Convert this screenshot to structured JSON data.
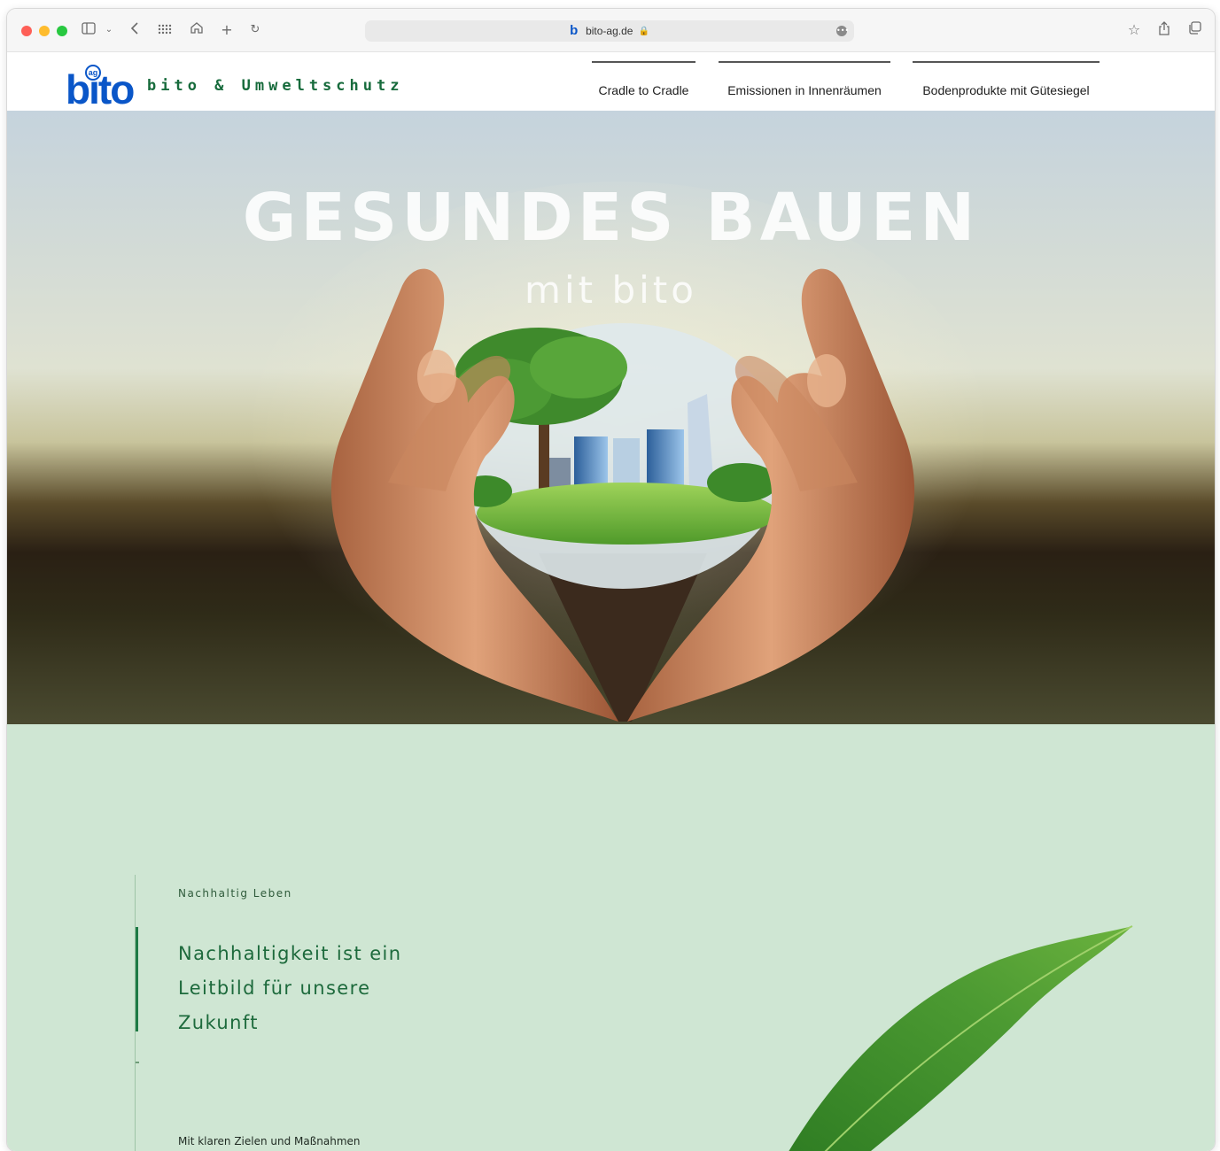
{
  "browser": {
    "url": "bito-ag.de",
    "favicon_letter": "b",
    "lock_glyph": "🔒",
    "icons": [
      "sidebar-icon",
      "chevron-down-icon",
      "back-icon",
      "grid-icon",
      "home-icon",
      "plus-icon",
      "reload-icon",
      "star-icon",
      "share-icon",
      "tabs-icon"
    ]
  },
  "site": {
    "logo_text": "bito",
    "logo_badge": "ag",
    "brand": "bito & Umweltschutz",
    "nav": [
      {
        "label": "Cradle to Cradle"
      },
      {
        "label": "Emissionen in Innenräumen"
      },
      {
        "label": "Bodenprodukte mit Gütesiegel"
      }
    ]
  },
  "hero": {
    "title": "GESUNDES BAUEN",
    "subtitle": "mit bito"
  },
  "section": {
    "eyebrow": "Nachhaltig Leben",
    "headline": "Nachhaltigkeit ist ein Leitbild für unsere Zukunft",
    "body": "Mit klaren Zielen und Maßnahmen"
  },
  "colors": {
    "brand_blue": "#0a56c8",
    "brand_green": "#176b3c",
    "section_bg": "#cfe6d3"
  }
}
